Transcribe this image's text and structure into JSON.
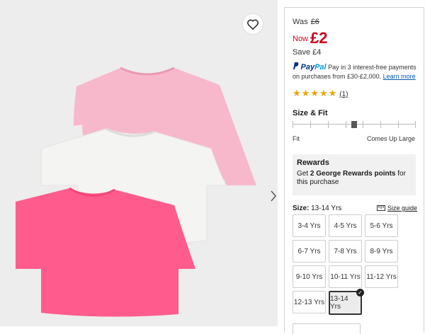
{
  "gallery": {
    "wishlist_icon": "heart-icon",
    "next_icon": "chevron-right-icon",
    "colors": {
      "pink_light": "#f8b8cc",
      "white_top": "#f4f4f2",
      "pink_neon": "#ff5c8d",
      "background": "#ededed"
    }
  },
  "price": {
    "was_label": "Was",
    "was_value": "£6",
    "now_label": "Now",
    "now_value": "£2",
    "save_label": "Save",
    "save_value": "£4",
    "accent": "#d0021b"
  },
  "paypal": {
    "logo_part1": "Pay",
    "logo_part2": "Pal",
    "text": "Pay in 3 interest-free payments on purchases from £30-£2,000.",
    "link": "Learn more"
  },
  "rating": {
    "stars": "★★★★★",
    "count": "(1)",
    "value": 5,
    "max": 5
  },
  "size_fit": {
    "title": "Size & Fit",
    "left_label": "Fit",
    "right_label": "Comes Up Large",
    "position": 0.5
  },
  "rewards": {
    "title": "Rewards",
    "text_pre": "Get ",
    "text_bold": "2 George Rewards points",
    "text_post": " for this purchase"
  },
  "size": {
    "label": "Size:",
    "selected": "13-14 Yrs",
    "guide": "Size guide",
    "options": [
      "3-4 Yrs",
      "4-5 Yrs",
      "5-6 Yrs",
      "6-7 Yrs",
      "7-8 Yrs",
      "8-9 Yrs",
      "9-10 Yrs",
      "10-11 Yrs",
      "11-12 Yrs",
      "12-13 Yrs",
      "13-14 Yrs"
    ]
  }
}
